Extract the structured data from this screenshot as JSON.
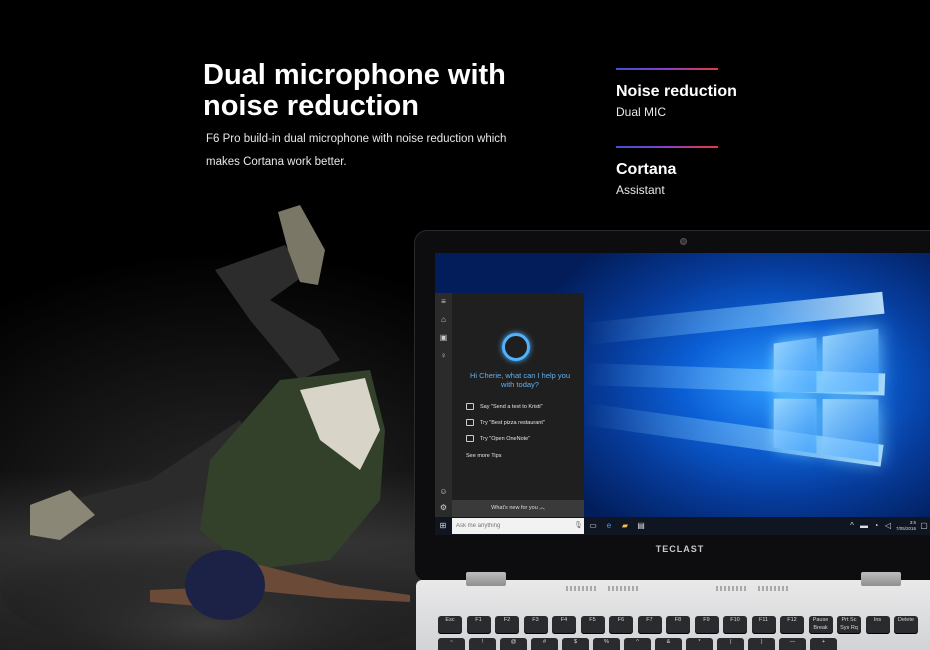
{
  "headline": {
    "title": "Dual microphone with noise reduction",
    "description": "F6 Pro build-in dual microphone with noise reduction which makes Cortana work better."
  },
  "features": [
    {
      "title": "Noise reduction",
      "subtitle": "Dual MIC"
    },
    {
      "title": "Cortana",
      "subtitle": "Assistant"
    }
  ],
  "colors": {
    "accent_gradient_start": "#3f4fd9",
    "accent_gradient_end": "#e6383b",
    "cortana_blue": "#4fb3ff"
  },
  "laptop": {
    "brand": "TECLAST",
    "cortana": {
      "greeting": "Hi Cherie, what can I help you with today?",
      "tips": [
        "Say \"Send a text to Kristi\"",
        "Try \"Best pizza restaurant\"",
        "Try \"Open OneNote\""
      ],
      "see_more": "See more Tips",
      "whats_new": "What's new for you",
      "ask_placeholder": "Ask me anything"
    },
    "taskbar": {
      "time": "3:5",
      "date": "7/05/2016"
    },
    "keyboard": {
      "row1": [
        "Esc",
        "F1",
        "F2",
        "F3",
        "F4",
        "F5",
        "F6",
        "F7",
        "F8",
        "F9",
        "F10",
        "F11",
        "F12",
        "Pause Break",
        "Prt Sc Sys Rq",
        "Ins",
        "Delete"
      ],
      "row2": [
        "~",
        "!",
        "@",
        "#",
        "$",
        "%",
        "^",
        "&",
        "*",
        "(",
        ")",
        "—",
        "+"
      ]
    }
  }
}
